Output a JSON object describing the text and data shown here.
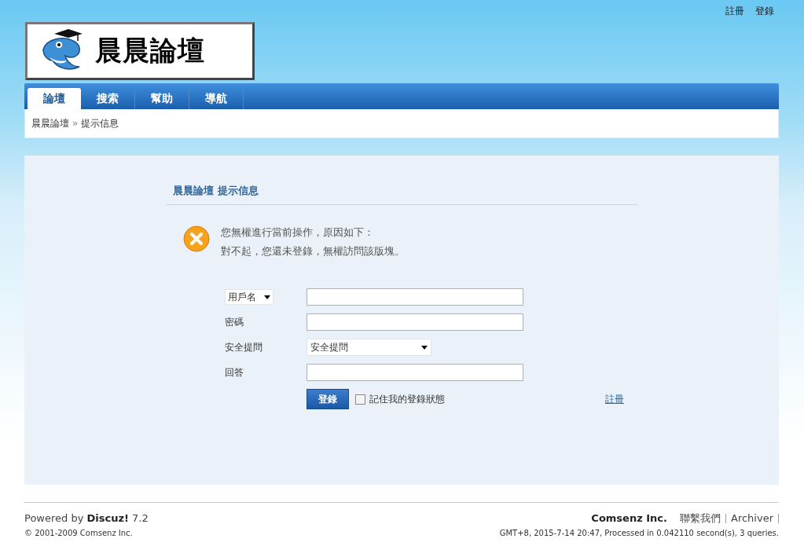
{
  "top_links": [
    "註冊",
    "登錄"
  ],
  "logo": {
    "title": "晨晨論壇"
  },
  "nav_tabs": [
    {
      "label": "論壇",
      "selected": true
    },
    {
      "label": "搜索",
      "selected": false
    },
    {
      "label": "幫助",
      "selected": false
    },
    {
      "label": "導航",
      "selected": false
    }
  ],
  "breadcrumb": {
    "home": "晨晨論壇",
    "separator": "»",
    "current": "提示信息"
  },
  "notice": {
    "title": "晨晨論壇 提示信息",
    "lines": [
      "您無權進行當前操作，原因如下：",
      "對不起，您還未登錄，無權訪問該版塊。"
    ]
  },
  "login_form": {
    "fields": [
      {
        "kind": "select-label",
        "label": "用戶名"
      },
      {
        "kind": "text",
        "label": "密碼"
      },
      {
        "kind": "select",
        "label": "安全提問",
        "value": "安全提問"
      },
      {
        "kind": "text",
        "label": "回答"
      }
    ],
    "submit": "登錄",
    "remember": {
      "label": "記住我的登錄狀態",
      "checked": false
    },
    "register_link": "註冊"
  },
  "footer": {
    "powered_prefix": "Powered by ",
    "product": "Discuz!",
    "version": " 7.2",
    "copyright": "© 2001-2009 Comsenz Inc.",
    "links": [
      {
        "label": "Comsenz Inc.",
        "bold": true
      },
      {
        "label": "聯繫我們",
        "bold": false
      },
      {
        "label": "Archiver",
        "bold": false
      }
    ],
    "stats": "GMT+8, 2015-7-14 20:47, Processed in 0.042110 second(s), 3 queries."
  }
}
